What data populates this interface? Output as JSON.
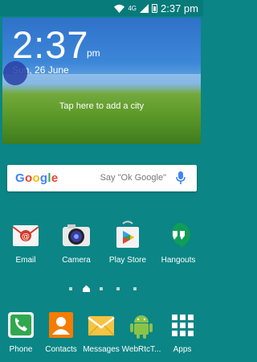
{
  "status_bar": {
    "network": "4G",
    "battery_percent": "%",
    "time": "2:37 pm"
  },
  "clock_widget": {
    "time": "2:37",
    "ampm": "pm",
    "date": "Sun, 26 June",
    "city_prompt": "Tap here to add a city"
  },
  "search": {
    "logo": [
      "G",
      "o",
      "o",
      "g",
      "l",
      "e"
    ],
    "hint": "Say \"Ok Google\""
  },
  "apps": [
    {
      "label": "Email",
      "icon": "email-icon"
    },
    {
      "label": "Camera",
      "icon": "camera-icon"
    },
    {
      "label": "Play Store",
      "icon": "play-store-icon"
    },
    {
      "label": "Hangouts",
      "icon": "hangouts-icon"
    }
  ],
  "dock": [
    {
      "label": "Phone",
      "icon": "phone-icon"
    },
    {
      "label": "Contacts",
      "icon": "contacts-icon"
    },
    {
      "label": "Messages",
      "icon": "messages-icon"
    },
    {
      "label": "WebRtcT...",
      "icon": "android-icon"
    },
    {
      "label": "Apps",
      "icon": "apps-grid-icon"
    }
  ],
  "colors": {
    "wallpaper": "#0b8585",
    "status_bar": "#077a7a"
  }
}
